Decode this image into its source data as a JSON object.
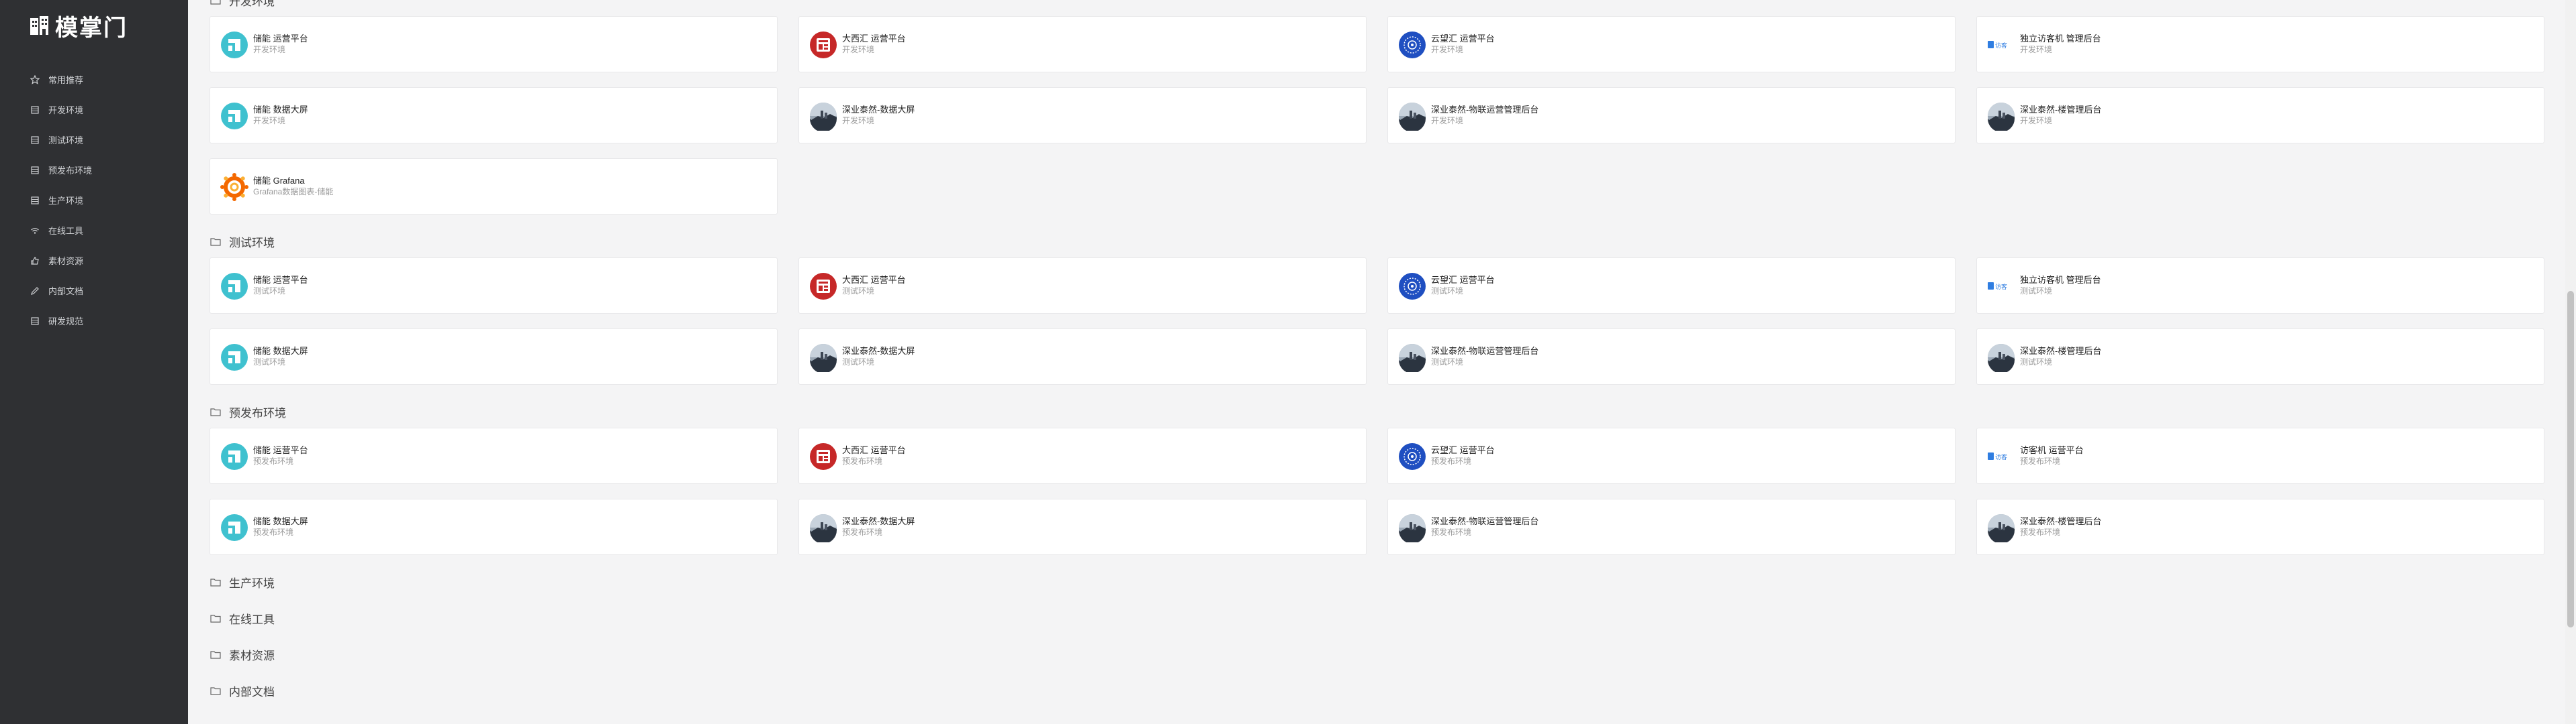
{
  "brand": {
    "logo_text": "模掌门"
  },
  "sidebar": {
    "items": [
      {
        "label": "常用推荐",
        "icon": "star-icon"
      },
      {
        "label": "开发环境",
        "icon": "server-icon"
      },
      {
        "label": "测试环境",
        "icon": "server-icon"
      },
      {
        "label": "预发布环境",
        "icon": "server-icon"
      },
      {
        "label": "生产环境",
        "icon": "server-icon"
      },
      {
        "label": "在线工具",
        "icon": "wifi-icon"
      },
      {
        "label": "素材资源",
        "icon": "thumbs-up-icon"
      },
      {
        "label": "内部文档",
        "icon": "pencil-icon"
      },
      {
        "label": "研发规范",
        "icon": "server-icon"
      }
    ]
  },
  "sections": [
    {
      "title": "开发环境",
      "cards": [
        {
          "title": "储能 运营平台",
          "subtitle": "开发环境",
          "icon": "chuneng-logo-icon"
        },
        {
          "title": "大西汇 运营平台",
          "subtitle": "开发环境",
          "icon": "daxihui-logo-icon"
        },
        {
          "title": "云望汇 运营平台",
          "subtitle": "开发环境",
          "icon": "yunwanghui-logo-icon"
        },
        {
          "title": "独立访客机 管理后台",
          "subtitle": "开发环境",
          "icon": "fangkeji-logo-icon"
        },
        {
          "title": "储能 数据大屏",
          "subtitle": "开发环境",
          "icon": "chuneng-logo-icon"
        },
        {
          "title": "深业泰然-数据大屏",
          "subtitle": "开发环境",
          "icon": "building-photo-icon"
        },
        {
          "title": "深业泰然-物联运营管理后台",
          "subtitle": "开发环境",
          "icon": "building-photo-icon"
        },
        {
          "title": "深业泰然-楼管理后台",
          "subtitle": "开发环境",
          "icon": "building-photo-icon"
        },
        {
          "title": "储能 Grafana",
          "subtitle": "Grafana数据图表-储能",
          "icon": "grafana-logo-icon"
        }
      ]
    },
    {
      "title": "测试环境",
      "cards": [
        {
          "title": "储能 运营平台",
          "subtitle": "测试环境",
          "icon": "chuneng-logo-icon"
        },
        {
          "title": "大西汇 运营平台",
          "subtitle": "测试环境",
          "icon": "daxihui-logo-icon"
        },
        {
          "title": "云望汇 运营平台",
          "subtitle": "测试环境",
          "icon": "yunwanghui-logo-icon"
        },
        {
          "title": "独立访客机 管理后台",
          "subtitle": "测试环境",
          "icon": "fangkeji-logo-icon"
        },
        {
          "title": "储能 数据大屏",
          "subtitle": "测试环境",
          "icon": "chuneng-logo-icon"
        },
        {
          "title": "深业泰然-数据大屏",
          "subtitle": "测试环境",
          "icon": "building-photo-icon"
        },
        {
          "title": "深业泰然-物联运营管理后台",
          "subtitle": "测试环境",
          "icon": "building-photo-icon"
        },
        {
          "title": "深业泰然-楼管理后台",
          "subtitle": "测试环境",
          "icon": "building-photo-icon"
        }
      ]
    },
    {
      "title": "预发布环境",
      "cards": [
        {
          "title": "储能 运营平台",
          "subtitle": "预发布环境",
          "icon": "chuneng-logo-icon"
        },
        {
          "title": "大西汇 运营平台",
          "subtitle": "预发布环境",
          "icon": "daxihui-logo-icon"
        },
        {
          "title": "云望汇 运营平台",
          "subtitle": "预发布环境",
          "icon": "yunwanghui-logo-icon"
        },
        {
          "title": "访客机 运营平台",
          "subtitle": "预发布环境",
          "icon": "fangkeji-logo-icon"
        },
        {
          "title": "储能 数据大屏",
          "subtitle": "预发布环境",
          "icon": "chuneng-logo-icon"
        },
        {
          "title": "深业泰然-数据大屏",
          "subtitle": "预发布环境",
          "icon": "building-photo-icon"
        },
        {
          "title": "深业泰然-物联运营管理后台",
          "subtitle": "预发布环境",
          "icon": "building-photo-icon"
        },
        {
          "title": "深业泰然-楼管理后台",
          "subtitle": "预发布环境",
          "icon": "building-photo-icon"
        }
      ]
    },
    {
      "title": "生产环境",
      "cards": []
    },
    {
      "title": "在线工具",
      "cards": []
    },
    {
      "title": "素材资源",
      "cards": []
    },
    {
      "title": "内部文档",
      "cards": []
    }
  ],
  "icon_text": {
    "fangkeji_mark": "访客"
  },
  "colors": {
    "sidebar_bg": "#2f3033",
    "page_bg": "#f4f4f5",
    "card_bg": "#ffffff",
    "chuneng": "#3fc1cf",
    "daxihui": "#c62828",
    "yunwanghui": "#1f4fc1",
    "fangkeji": "#2f7de1",
    "grafana": "#f46800"
  }
}
